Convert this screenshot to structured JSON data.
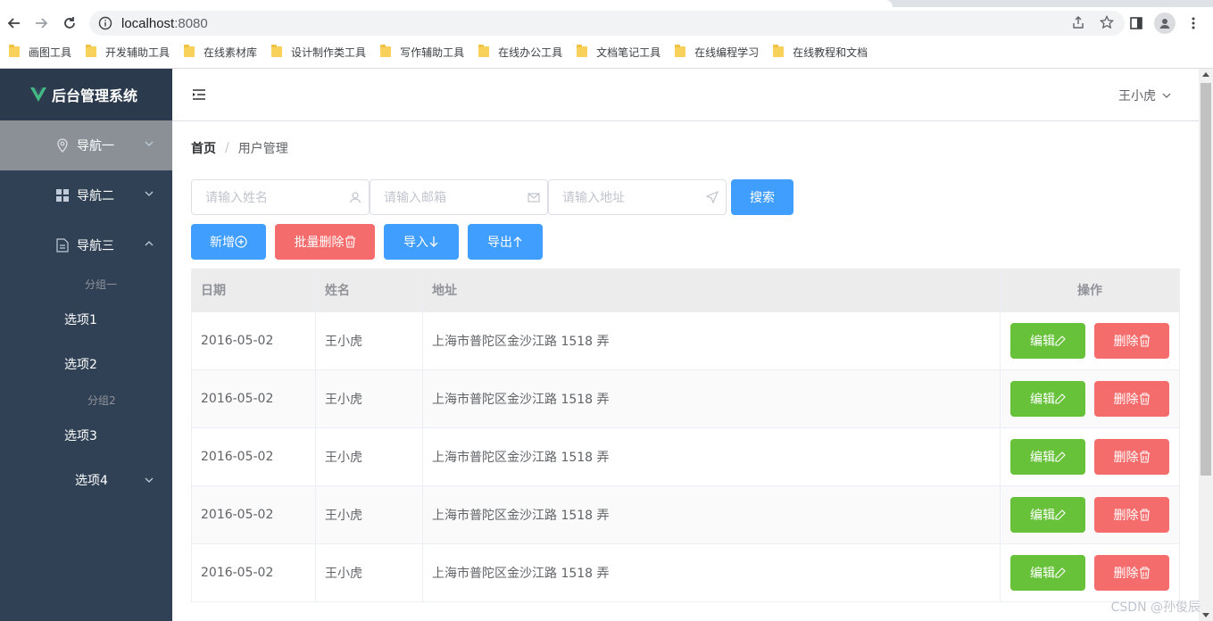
{
  "browser": {
    "url_host": "localhost",
    "url_port": ":8080",
    "bookmarks": [
      "画图工具",
      "开发辅助工具",
      "在线素材库",
      "设计制作类工具",
      "写作辅助工具",
      "在线办公工具",
      "文档笔记工具",
      "在线编程学习",
      "在线教程和文档"
    ]
  },
  "sidebar": {
    "logo_text": "后台管理系统",
    "nav1": "导航一",
    "nav2": "导航二",
    "nav3": "导航三",
    "group1": "分组一",
    "opt1": "选项1",
    "opt2": "选项2",
    "group2": "分组2",
    "opt3": "选项3",
    "opt4": "选项4"
  },
  "header": {
    "user": "王小虎"
  },
  "breadcrumb": {
    "home": "首页",
    "sep": "/",
    "current": "用户管理"
  },
  "search": {
    "name_placeholder": "请输入姓名",
    "email_placeholder": "请输入邮箱",
    "address_placeholder": "请输入地址",
    "search_label": "搜索"
  },
  "actions": {
    "add": "新增",
    "batch_delete": "批量删除",
    "import": "导入",
    "export": "导出"
  },
  "table": {
    "headers": {
      "date": "日期",
      "name": "姓名",
      "address": "地址",
      "op": "操作"
    },
    "rows": [
      {
        "date": "2016-05-02",
        "name": "王小虎",
        "address": "上海市普陀区金沙江路 1518 弄"
      },
      {
        "date": "2016-05-02",
        "name": "王小虎",
        "address": "上海市普陀区金沙江路 1518 弄"
      },
      {
        "date": "2016-05-02",
        "name": "王小虎",
        "address": "上海市普陀区金沙江路 1518 弄"
      },
      {
        "date": "2016-05-02",
        "name": "王小虎",
        "address": "上海市普陀区金沙江路 1518 弄"
      },
      {
        "date": "2016-05-02",
        "name": "王小虎",
        "address": "上海市普陀区金沙江路 1518 弄"
      }
    ],
    "edit_label": "编辑",
    "delete_label": "删除"
  },
  "watermark": "CSDN @孙俊辰",
  "colors": {
    "primary": "#409eff",
    "danger": "#f56c6c",
    "success": "#67c23a",
    "sidebar": "#304156",
    "logo": "#42b983"
  }
}
